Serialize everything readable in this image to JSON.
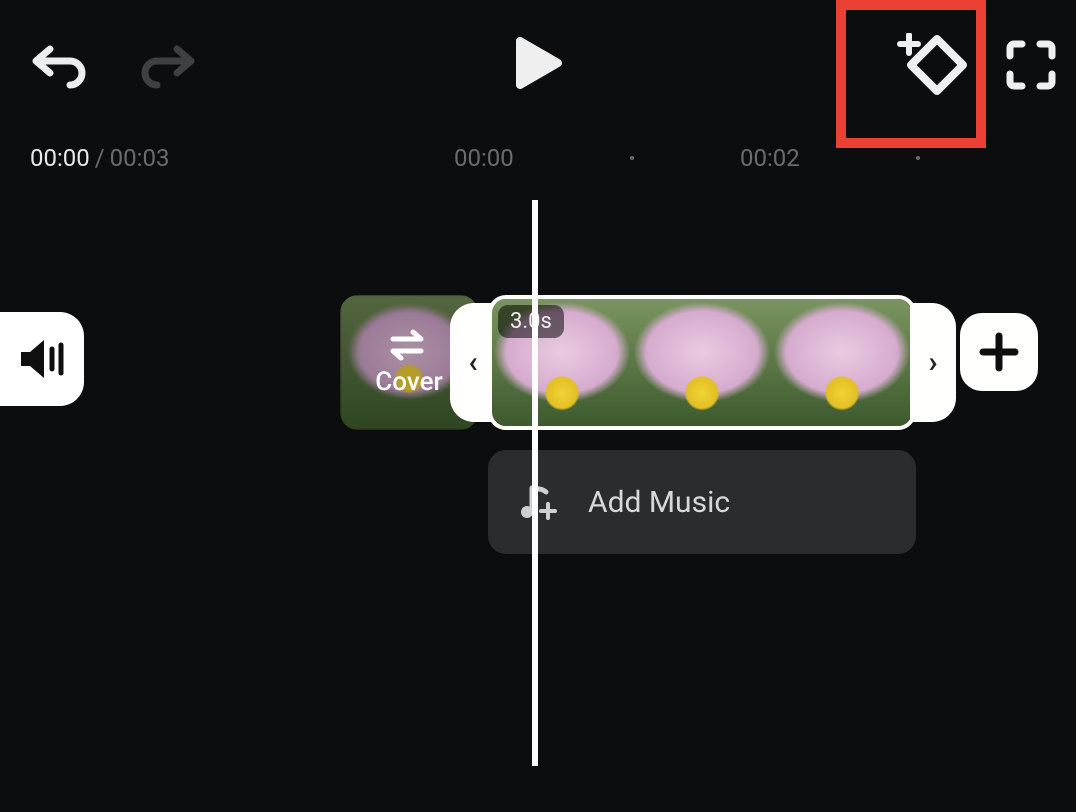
{
  "toolbar": {
    "undo": "undo",
    "redo": "redo",
    "play": "play",
    "keyframe": "keyframe",
    "fullscreen": "fullscreen"
  },
  "time": {
    "current": "00:00",
    "separator": "/",
    "total": "00:03"
  },
  "ruler": {
    "marks": [
      "00:00",
      "00:02"
    ]
  },
  "clip": {
    "cover_label": "Cover",
    "duration_label": "3.0s"
  },
  "music": {
    "add_label": "Add Music"
  },
  "highlight": {
    "target": "keyframe-button",
    "color": "#ea4134"
  }
}
